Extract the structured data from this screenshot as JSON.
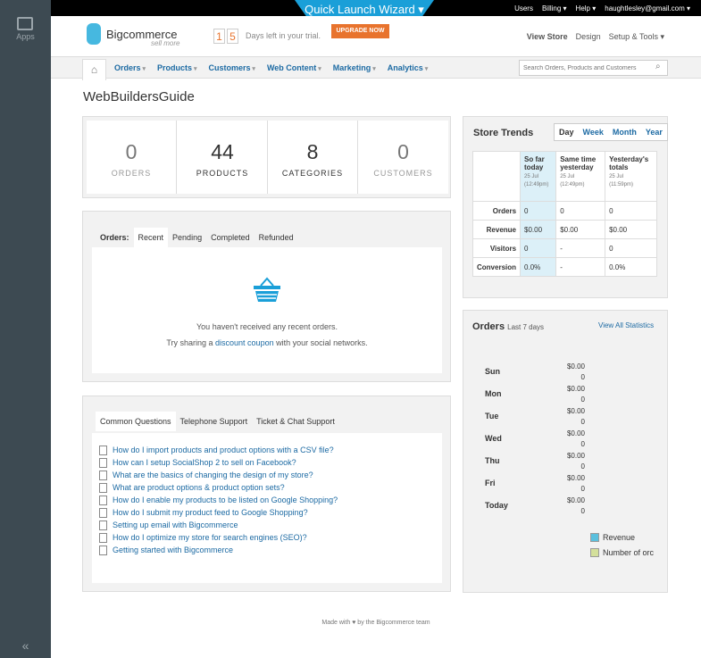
{
  "apps": {
    "label": "Apps",
    "icon": "store-icon",
    "collapse": "«"
  },
  "wizard": {
    "label": "Quick Launch Wizard ▾"
  },
  "toplinks": {
    "users": "Users",
    "billing": "Billing",
    "help": "Help",
    "account": "haughtlesley@gmail.com"
  },
  "brand": {
    "name": "Bigcommerce",
    "tagline": "sell more"
  },
  "trial": {
    "digit1": "1",
    "digit2": "5",
    "text": "Days left in your trial.",
    "upgrade": "UPGRADE NOW"
  },
  "header_links": {
    "view_store": "View Store",
    "design": "Design",
    "setup": "Setup & Tools ▾"
  },
  "nav": {
    "items": [
      "Orders",
      "Products",
      "Customers",
      "Web Content",
      "Marketing",
      "Analytics"
    ],
    "search_placeholder": "Search Orders, Products and Customers"
  },
  "page_title": "WebBuildersGuide",
  "stats": [
    {
      "value": "0",
      "label": "ORDERS"
    },
    {
      "value": "44",
      "label": "PRODUCTS"
    },
    {
      "value": "8",
      "label": "CATEGORIES"
    },
    {
      "value": "0",
      "label": "CUSTOMERS"
    }
  ],
  "orders_tabs": {
    "label": "Orders:",
    "tabs": [
      "Recent",
      "Pending",
      "Completed",
      "Refunded"
    ]
  },
  "orders_empty": {
    "line1": "You haven't received any recent orders.",
    "line2_pre": "Try sharing a",
    "link": "discount coupon",
    "line2_post": "with your social networks."
  },
  "support_tabs": [
    "Common Questions",
    "Telephone Support",
    "Ticket & Chat Support"
  ],
  "faq": [
    "How do I import products and product options with a CSV file?",
    "How can I setup SocialShop 2 to sell on Facebook?",
    "What are the basics of changing the design of my store?",
    "What are product options & product option sets?",
    "How do I enable my products to be listed on Google Shopping?",
    "How do I submit my product feed to Google Shopping?",
    "Setting up email with Bigcommerce",
    "How do I optimize my store for search engines (SEO)?",
    "Getting started with Bigcommerce"
  ],
  "trends": {
    "title": "Store Trends",
    "periods": [
      "Day",
      "Week",
      "Month",
      "Year"
    ],
    "columns": [
      {
        "title": "So far today",
        "date": "25 Jul",
        "time": "(12:49pm)"
      },
      {
        "title": "Same time yesterday",
        "date": "25 Jul",
        "time": "(12:49pm)"
      },
      {
        "title": "Yesterday's totals",
        "date": "25 Jul",
        "time": "(11:59pm)"
      }
    ],
    "rows": [
      {
        "label": "Orders",
        "values": [
          "0",
          "0",
          "0"
        ]
      },
      {
        "label": "Revenue",
        "values": [
          "$0.00",
          "$0.00",
          "$0.00"
        ]
      },
      {
        "label": "Visitors",
        "values": [
          "0",
          "-",
          "0"
        ]
      },
      {
        "label": "Conversion",
        "values": [
          "0.0%",
          "-",
          "0.0%"
        ]
      }
    ]
  },
  "orders_chart": {
    "title": "Orders",
    "subtitle": "Last 7 days",
    "link": "View All Statistics",
    "days": [
      {
        "day": "Sun",
        "revenue": "$0.00",
        "orders": "0"
      },
      {
        "day": "Mon",
        "revenue": "$0.00",
        "orders": "0"
      },
      {
        "day": "Tue",
        "revenue": "$0.00",
        "orders": "0"
      },
      {
        "day": "Wed",
        "revenue": "$0.00",
        "orders": "0"
      },
      {
        "day": "Thu",
        "revenue": "$0.00",
        "orders": "0"
      },
      {
        "day": "Fri",
        "revenue": "$0.00",
        "orders": "0"
      },
      {
        "day": "Today",
        "revenue": "$0.00",
        "orders": "0"
      }
    ],
    "legend": [
      {
        "label": "Revenue",
        "color": "#5bc0de"
      },
      {
        "label": "Number of orc",
        "color": "#d4e09b"
      }
    ]
  },
  "footer": {
    "text": "Made with ♥ by the Bigcommerce team"
  }
}
